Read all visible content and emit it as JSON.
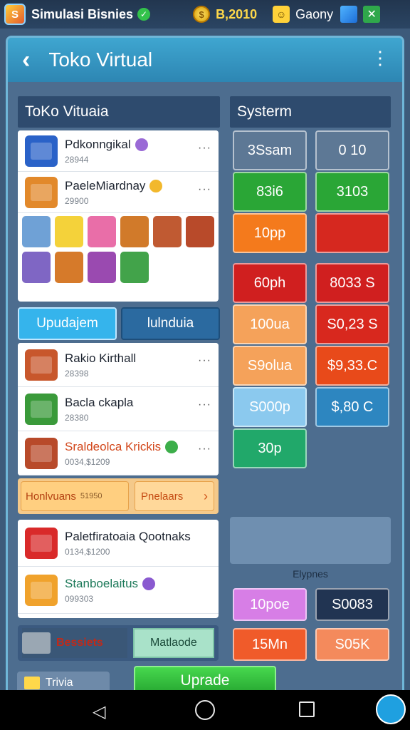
{
  "topbar": {
    "app_name": "Simulasi Bisnies",
    "money": "B,2010",
    "game_label": "Gaony"
  },
  "header": {
    "title": "Toko Virtual"
  },
  "left": {
    "section_title": "ToKo Vituaia",
    "top_items": [
      {
        "name": "Pdkonngikal",
        "sub": "28944"
      },
      {
        "name": "PaeleMiardnay",
        "sub": "29900"
      }
    ],
    "tabs": [
      "Upudajem",
      "lulnduia"
    ],
    "mid_items": [
      {
        "name": "Rakio Kirthall",
        "sub": "28398"
      },
      {
        "name": "Bacla ckapla",
        "sub": "28380"
      },
      {
        "name": "Sraldeolca Krickis",
        "sub": "0034,$1209"
      }
    ],
    "promo": [
      "Honlvuans",
      "Pnelaars"
    ],
    "promo_sub": "51950",
    "low_items": [
      {
        "name": "Paletfiratoaia Qootnaks",
        "sub": "0134,$1200"
      },
      {
        "name": "Stanboelaitus",
        "sub": "099303"
      }
    ],
    "footer_left": "Bessiets",
    "footer_right": "Matlaode"
  },
  "right": {
    "section_title": "Systerm",
    "buttons": [
      {
        "label": "3Ssam",
        "color": "#5d7895"
      },
      {
        "label": "0 10",
        "color": "#5d7895"
      },
      {
        "label": "83i6",
        "color": "#2aa636"
      },
      {
        "label": "3103",
        "color": "#2aa636"
      },
      {
        "label": "10pp",
        "color": "#f47a1c"
      },
      {
        "label": "",
        "color": "#d6281f"
      },
      {
        "label": "60ph",
        "color": "#d01f1f"
      },
      {
        "label": "8033 S",
        "color": "#d01f1f"
      },
      {
        "label": "100ua",
        "color": "#f5a25a"
      },
      {
        "label": "S0,23 S",
        "color": "#d8281e"
      },
      {
        "label": "S9olua",
        "color": "#f5a25a"
      },
      {
        "label": "$9,33.C",
        "color": "#e84a1a"
      },
      {
        "label": "S000p",
        "color": "#8bc9ee"
      },
      {
        "label": "$,80 C",
        "color": "#2d86c0"
      },
      {
        "label": "30p",
        "color": "#21a86a"
      }
    ],
    "caption": "Elypnes",
    "bottom_buttons": [
      {
        "label": "10poe",
        "color": "#d77ee6"
      },
      {
        "label": "S0083",
        "color": "#213452"
      },
      {
        "label": "15Mn",
        "color": "#f05b2a"
      },
      {
        "label": "S05K",
        "color": "#f48a5c"
      }
    ]
  },
  "bottom": {
    "trivia": "Trivia",
    "upgrade": "Uprade"
  }
}
